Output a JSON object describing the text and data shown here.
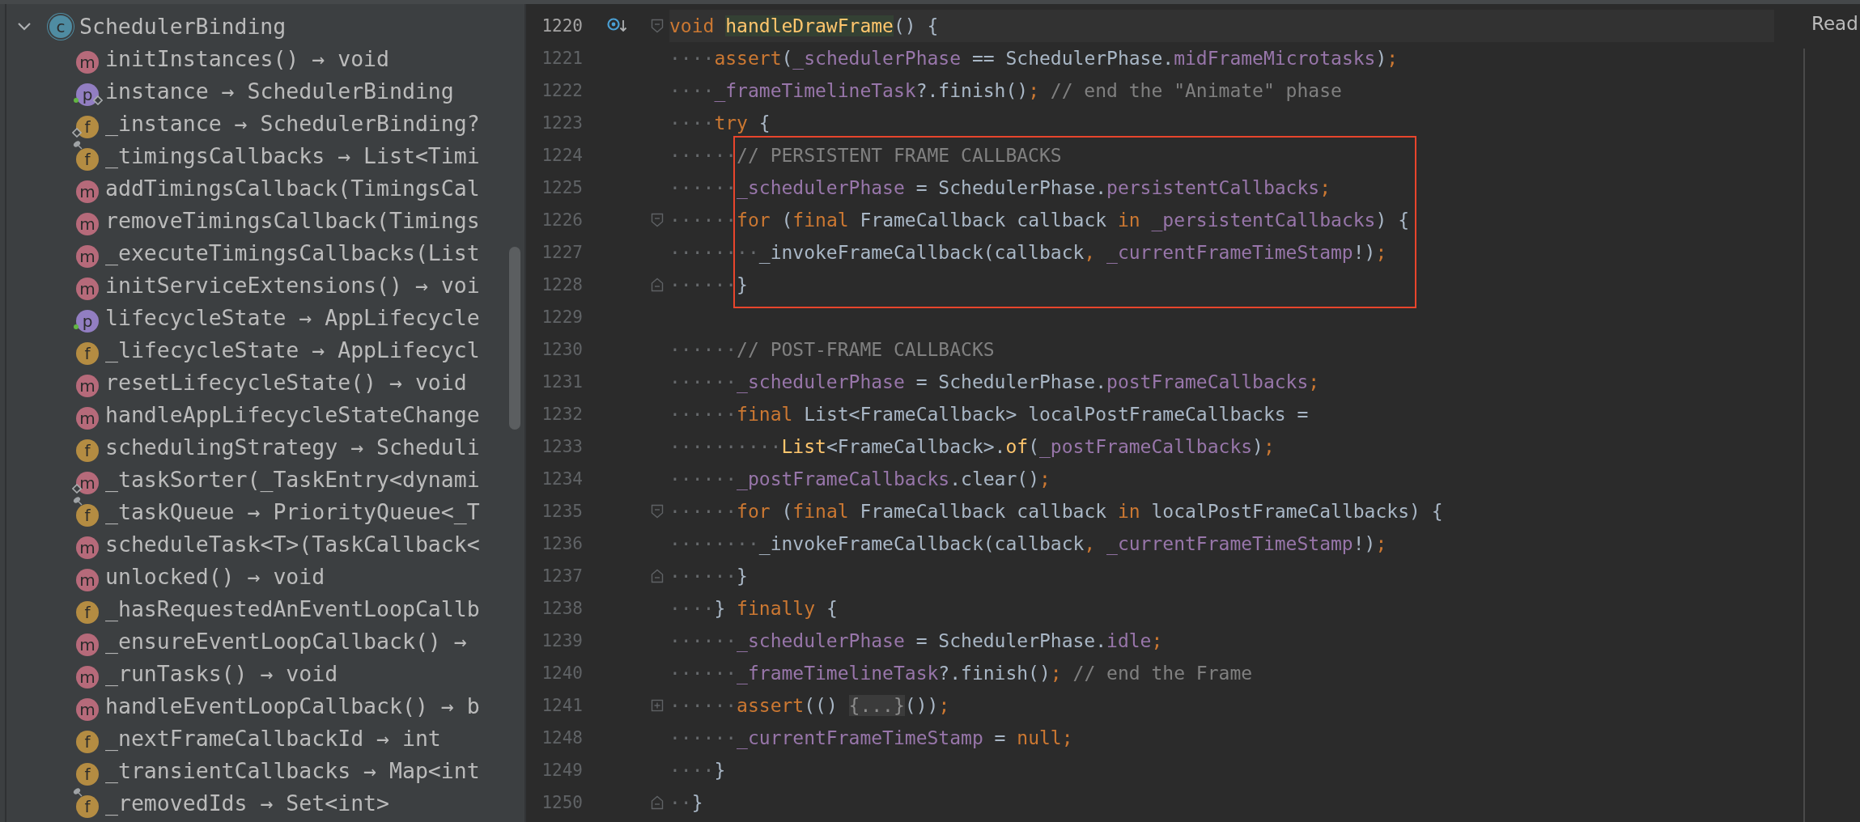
{
  "structure": {
    "label": "SchedulerBinding",
    "badge": "c",
    "kind": "class",
    "expanded": true,
    "children": [
      {
        "label": "initInstances() → void",
        "badge": "m",
        "kind": "method",
        "public": false,
        "static": false,
        "final": false
      },
      {
        "label": "instance → SchedulerBinding",
        "badge": "p",
        "kind": "property",
        "public": true,
        "static": true,
        "final": false
      },
      {
        "label": "_instance → SchedulerBinding?",
        "badge": "f",
        "kind": "field",
        "public": false,
        "static": true,
        "final": false
      },
      {
        "label": "_timingsCallbacks → List<Timi",
        "badge": "f",
        "kind": "field",
        "public": false,
        "static": false,
        "final": true
      },
      {
        "label": "addTimingsCallback(TimingsCal",
        "badge": "m",
        "kind": "method",
        "public": false,
        "static": false,
        "final": false
      },
      {
        "label": "removeTimingsCallback(Timings",
        "badge": "m",
        "kind": "method",
        "public": false,
        "static": false,
        "final": false
      },
      {
        "label": "_executeTimingsCallbacks(List",
        "badge": "m",
        "kind": "method",
        "public": false,
        "static": false,
        "final": false
      },
      {
        "label": "initServiceExtensions() → voi",
        "badge": "m",
        "kind": "method",
        "public": false,
        "static": false,
        "final": false
      },
      {
        "label": "lifecycleState → AppLifecycle",
        "badge": "p",
        "kind": "property",
        "public": true,
        "static": false,
        "final": false
      },
      {
        "label": "_lifecycleState → AppLifecycl",
        "badge": "f",
        "kind": "field",
        "public": false,
        "static": false,
        "final": false
      },
      {
        "label": "resetLifecycleState() → void",
        "badge": "m",
        "kind": "method",
        "public": false,
        "static": false,
        "final": false
      },
      {
        "label": "handleAppLifecycleStateChange",
        "badge": "m",
        "kind": "method",
        "public": false,
        "static": false,
        "final": false
      },
      {
        "label": "schedulingStrategy → Scheduli",
        "badge": "f",
        "kind": "field",
        "public": false,
        "static": false,
        "final": false
      },
      {
        "label": "_taskSorter(_TaskEntry<dynami",
        "badge": "m",
        "kind": "method",
        "public": false,
        "static": true,
        "final": false
      },
      {
        "label": "_taskQueue → PriorityQueue<_T",
        "badge": "f",
        "kind": "field",
        "public": false,
        "static": false,
        "final": true
      },
      {
        "label": "scheduleTask<T>(TaskCallback<",
        "badge": "m",
        "kind": "method",
        "public": false,
        "static": false,
        "final": false
      },
      {
        "label": "unlocked() → void",
        "badge": "m",
        "kind": "method",
        "public": false,
        "static": false,
        "final": false
      },
      {
        "label": "_hasRequestedAnEventLoopCallb",
        "badge": "f",
        "kind": "field",
        "public": false,
        "static": false,
        "final": false
      },
      {
        "label": "_ensureEventLoopCallback() →",
        "badge": "m",
        "kind": "method",
        "public": false,
        "static": false,
        "final": false
      },
      {
        "label": "_runTasks() → void",
        "badge": "m",
        "kind": "method",
        "public": false,
        "static": false,
        "final": false
      },
      {
        "label": "handleEventLoopCallback() → b",
        "badge": "m",
        "kind": "method",
        "public": false,
        "static": false,
        "final": false
      },
      {
        "label": "_nextFrameCallbackId → int",
        "badge": "f",
        "kind": "field",
        "public": false,
        "static": false,
        "final": false
      },
      {
        "label": "_transientCallbacks → Map<int",
        "badge": "f",
        "kind": "field",
        "public": false,
        "static": false,
        "final": false
      },
      {
        "label": "_removedIds → Set<int>",
        "badge": "f",
        "kind": "field",
        "public": false,
        "static": false,
        "final": true
      }
    ]
  },
  "code": {
    "lines": [
      {
        "number": "1220",
        "current": true,
        "boxed": false,
        "marker": {
          "kind": "overrides"
        },
        "fold": {
          "kind": "start"
        },
        "tokens": [
          {
            "kind": "keyword",
            "text": "void "
          },
          {
            "kind": "definition",
            "text": "handleDrawFrame"
          },
          {
            "kind": "plain",
            "text": "() {"
          }
        ]
      },
      {
        "number": "1221",
        "current": false,
        "boxed": false,
        "indent": "····",
        "tokens": [
          {
            "kind": "keyword",
            "text": "assert"
          },
          {
            "kind": "plain",
            "text": "("
          },
          {
            "kind": "field",
            "text": "_schedulerPhase"
          },
          {
            "kind": "plain",
            "text": " == SchedulerPhase."
          },
          {
            "kind": "field",
            "text": "midFrameMicrotasks"
          },
          {
            "kind": "plain",
            "text": ")"
          },
          {
            "kind": "keyword",
            "text": ";"
          }
        ]
      },
      {
        "number": "1222",
        "current": false,
        "boxed": false,
        "indent": "····",
        "tokens": [
          {
            "kind": "field",
            "text": "_frameTimelineTask"
          },
          {
            "kind": "plain",
            "text": "?.finish()"
          },
          {
            "kind": "keyword",
            "text": ";"
          },
          {
            "kind": "comment",
            "text": " // end the \"Animate\" phase"
          }
        ]
      },
      {
        "number": "1223",
        "current": false,
        "boxed": false,
        "indent": "····",
        "tokens": [
          {
            "kind": "keyword",
            "text": "try"
          },
          {
            "kind": "plain",
            "text": " {"
          }
        ]
      },
      {
        "number": "1224",
        "current": false,
        "boxed": true,
        "indent": "······",
        "tokens": [
          {
            "kind": "comment",
            "text": "// PERSISTENT FRAME CALLBACKS"
          }
        ]
      },
      {
        "number": "1225",
        "current": false,
        "boxed": true,
        "indent": "······",
        "tokens": [
          {
            "kind": "field",
            "text": "_schedulerPhase"
          },
          {
            "kind": "plain",
            "text": " = SchedulerPhase."
          },
          {
            "kind": "field",
            "text": "persistentCallbacks"
          },
          {
            "kind": "keyword",
            "text": ";"
          }
        ]
      },
      {
        "number": "1226",
        "current": false,
        "boxed": true,
        "fold": {
          "kind": "start"
        },
        "indent": "······",
        "tokens": [
          {
            "kind": "keyword",
            "text": "for"
          },
          {
            "kind": "plain",
            "text": " ("
          },
          {
            "kind": "keyword",
            "text": "final"
          },
          {
            "kind": "plain",
            "text": " FrameCallback callback "
          },
          {
            "kind": "keyword",
            "text": "in "
          },
          {
            "kind": "field",
            "text": "_persistentCallbacks"
          },
          {
            "kind": "plain",
            "text": ") {"
          }
        ]
      },
      {
        "number": "1227",
        "current": false,
        "boxed": true,
        "indent": "········",
        "tokens": [
          {
            "kind": "plain",
            "text": "_invokeFrameCallback(callback"
          },
          {
            "kind": "keyword",
            "text": ", "
          },
          {
            "kind": "field",
            "text": "_currentFrameTimeStamp"
          },
          {
            "kind": "plain",
            "text": "!)"
          },
          {
            "kind": "keyword",
            "text": ";"
          }
        ]
      },
      {
        "number": "1228",
        "current": false,
        "boxed": true,
        "fold": {
          "kind": "end"
        },
        "indent": "······",
        "tokens": [
          {
            "kind": "plain",
            "text": "}"
          }
        ]
      },
      {
        "number": "1229",
        "current": false,
        "boxed": false
      },
      {
        "number": "1230",
        "current": false,
        "boxed": false,
        "indent": "······",
        "tokens": [
          {
            "kind": "comment",
            "text": "// POST-FRAME CALLBACKS"
          }
        ]
      },
      {
        "number": "1231",
        "current": false,
        "boxed": false,
        "indent": "······",
        "tokens": [
          {
            "kind": "field",
            "text": "_schedulerPhase"
          },
          {
            "kind": "plain",
            "text": " = SchedulerPhase."
          },
          {
            "kind": "field",
            "text": "postFrameCallbacks"
          },
          {
            "kind": "keyword",
            "text": ";"
          }
        ]
      },
      {
        "number": "1232",
        "current": false,
        "boxed": false,
        "indent": "······",
        "tokens": [
          {
            "kind": "keyword",
            "text": "final"
          },
          {
            "kind": "plain",
            "text": " List<FrameCallback> localPostFrameCallbacks ="
          }
        ]
      },
      {
        "number": "1233",
        "current": false,
        "boxed": false,
        "indent": "··········",
        "tokens": [
          {
            "kind": "call",
            "text": "List"
          },
          {
            "kind": "plain",
            "text": "<FrameCallback>."
          },
          {
            "kind": "call",
            "text": "of"
          },
          {
            "kind": "plain",
            "text": "("
          },
          {
            "kind": "field",
            "text": "_postFrameCallbacks"
          },
          {
            "kind": "plain",
            "text": ")"
          },
          {
            "kind": "keyword",
            "text": ";"
          }
        ]
      },
      {
        "number": "1234",
        "current": false,
        "boxed": false,
        "indent": "······",
        "tokens": [
          {
            "kind": "field",
            "text": "_postFrameCallbacks"
          },
          {
            "kind": "plain",
            "text": ".clear()"
          },
          {
            "kind": "keyword",
            "text": ";"
          }
        ]
      },
      {
        "number": "1235",
        "current": false,
        "boxed": false,
        "fold": {
          "kind": "start"
        },
        "indent": "······",
        "tokens": [
          {
            "kind": "keyword",
            "text": "for"
          },
          {
            "kind": "plain",
            "text": " ("
          },
          {
            "kind": "keyword",
            "text": "final"
          },
          {
            "kind": "plain",
            "text": " FrameCallback callback "
          },
          {
            "kind": "keyword",
            "text": "in"
          },
          {
            "kind": "plain",
            "text": " localPostFrameCallbacks) {"
          }
        ]
      },
      {
        "number": "1236",
        "current": false,
        "boxed": false,
        "indent": "········",
        "tokens": [
          {
            "kind": "plain",
            "text": "_invokeFrameCallback(callback"
          },
          {
            "kind": "keyword",
            "text": ", "
          },
          {
            "kind": "field",
            "text": "_currentFrameTimeStamp"
          },
          {
            "kind": "plain",
            "text": "!)"
          },
          {
            "kind": "keyword",
            "text": ";"
          }
        ]
      },
      {
        "number": "1237",
        "current": false,
        "boxed": false,
        "fold": {
          "kind": "end"
        },
        "indent": "······",
        "tokens": [
          {
            "kind": "plain",
            "text": "}"
          }
        ]
      },
      {
        "number": "1238",
        "current": false,
        "boxed": false,
        "indent": "····",
        "tokens": [
          {
            "kind": "plain",
            "text": "} "
          },
          {
            "kind": "keyword",
            "text": "finally"
          },
          {
            "kind": "plain",
            "text": " {"
          }
        ]
      },
      {
        "number": "1239",
        "current": false,
        "boxed": false,
        "indent": "······",
        "tokens": [
          {
            "kind": "field",
            "text": "_schedulerPhase"
          },
          {
            "kind": "plain",
            "text": " = SchedulerPhase."
          },
          {
            "kind": "field",
            "text": "idle"
          },
          {
            "kind": "keyword",
            "text": ";"
          }
        ]
      },
      {
        "number": "1240",
        "current": false,
        "boxed": false,
        "indent": "······",
        "tokens": [
          {
            "kind": "field",
            "text": "_frameTimelineTask"
          },
          {
            "kind": "plain",
            "text": "?.finish()"
          },
          {
            "kind": "keyword",
            "text": ";"
          },
          {
            "kind": "comment",
            "text": " // end the Frame"
          }
        ]
      },
      {
        "number": "1241",
        "current": false,
        "boxed": false,
        "fold": {
          "kind": "collapsed"
        },
        "indent": "······",
        "tokens": [
          {
            "kind": "keyword",
            "text": "assert"
          },
          {
            "kind": "plain",
            "text": "(() "
          },
          {
            "kind": "folded",
            "text": "{...}"
          },
          {
            "kind": "plain",
            "text": "())"
          },
          {
            "kind": "keyword",
            "text": ";"
          }
        ]
      },
      {
        "number": "1248",
        "current": false,
        "boxed": false,
        "indent": "······",
        "tokens": [
          {
            "kind": "field",
            "text": "_currentFrameTimeStamp"
          },
          {
            "kind": "plain",
            "text": " = "
          },
          {
            "kind": "keyword",
            "text": "null"
          },
          {
            "kind": "keyword",
            "text": ";"
          }
        ]
      },
      {
        "number": "1249",
        "current": false,
        "boxed": false,
        "indent": "····",
        "tokens": [
          {
            "kind": "plain",
            "text": "}"
          }
        ]
      },
      {
        "number": "1250",
        "current": false,
        "boxed": false,
        "fold": {
          "kind": "end"
        },
        "indent": "··",
        "tokens": [
          {
            "kind": "plain",
            "text": "}"
          }
        ]
      }
    ]
  },
  "corner_label": "Read"
}
